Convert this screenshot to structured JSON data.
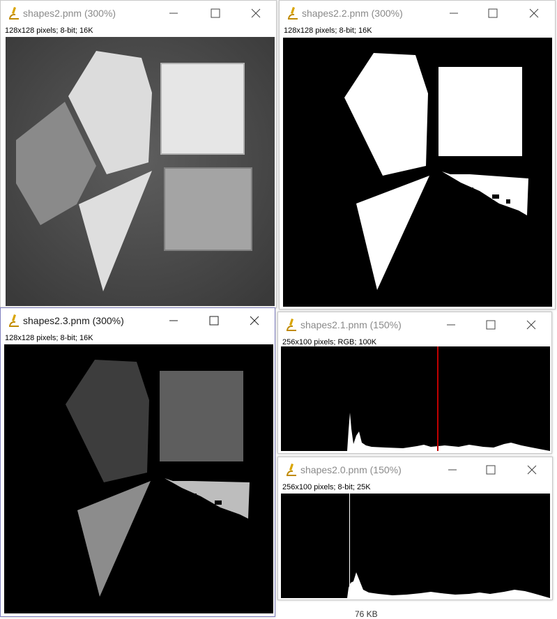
{
  "windows": [
    {
      "id": "w1",
      "title": "shapes2.pnm (300%)",
      "info": "128x128 pixels; 8-bit; 16K"
    },
    {
      "id": "w2",
      "title": "shapes2.2.pnm (300%)",
      "info": "128x128 pixels; 8-bit; 16K"
    },
    {
      "id": "w3",
      "title": "shapes2.3.pnm (300%)",
      "info": "128x128 pixels; 8-bit; 16K"
    },
    {
      "id": "w4",
      "title": "shapes2.1.pnm (150%)",
      "info": "256x100 pixels; RGB; 100K"
    },
    {
      "id": "w5",
      "title": "shapes2.0.pnm (150%)",
      "info": "256x100 pixels; 8-bit; 25K"
    }
  ],
  "status_bar": {
    "size": "76 KB"
  },
  "icons": {
    "app": "imagej-microscope-icon",
    "minimize": "minimize-icon",
    "maximize": "maximize-icon",
    "close": "close-icon"
  },
  "colors": {
    "marker_red": "#c00000",
    "histogram_white": "#ffffff",
    "canvas_bg": "#000000"
  }
}
